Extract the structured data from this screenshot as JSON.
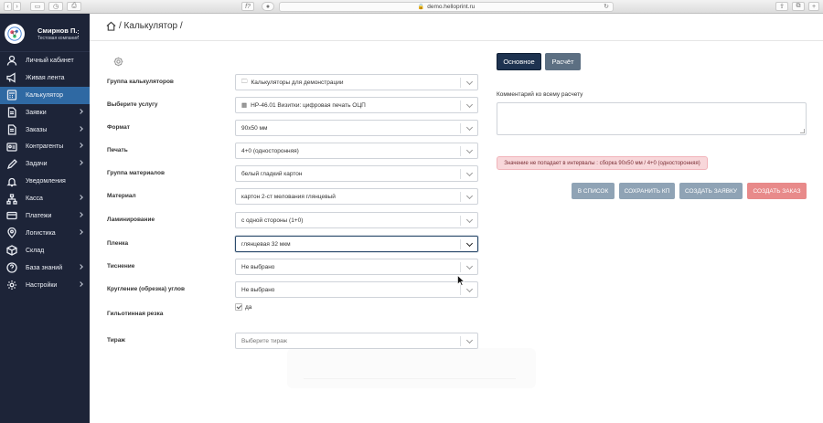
{
  "browser": {
    "url": "demo.helloprint.ru",
    "tab_label": "f?"
  },
  "profile": {
    "name": "Смирнов П.",
    "company": "Тестовая компания"
  },
  "sidebar": {
    "items": [
      {
        "label": "Личный кабинет",
        "icon": "user-icon"
      },
      {
        "label": "Живая лента",
        "icon": "megaphone-icon"
      },
      {
        "label": "Калькулятор",
        "icon": "calculator-icon",
        "active": true
      },
      {
        "label": "Заявки",
        "icon": "document-icon"
      },
      {
        "label": "Заказы",
        "icon": "document-icon"
      },
      {
        "label": "Контрагенты",
        "icon": "contact-card-icon"
      },
      {
        "label": "Задачи",
        "icon": "pencil-icon"
      },
      {
        "label": "Уведомления",
        "icon": "bell-icon"
      },
      {
        "label": "Касса",
        "icon": "sitemap-icon"
      },
      {
        "label": "Платежи",
        "icon": "card-icon"
      },
      {
        "label": "Логистика",
        "icon": "location-pin-icon"
      },
      {
        "label": "Склад",
        "icon": "box-icon"
      },
      {
        "label": "База знаний",
        "icon": "help-circle-icon"
      },
      {
        "label": "Настройки",
        "icon": "gear-icon"
      }
    ]
  },
  "breadcrumb": {
    "text": "/ Калькулятор /"
  },
  "form": {
    "rows": [
      {
        "label": "Группа калькуляторов",
        "value": "Калькуляторы для демонстрации",
        "prefix": "🗀"
      },
      {
        "label": "Выберите услугу",
        "value": "HP-46.01 Визитки: цифровая печать ОЦП",
        "prefix": "▦"
      },
      {
        "label": "Формат",
        "value": "90x50 мм"
      },
      {
        "label": "Печать",
        "value": "4+0 (односторонняя)"
      },
      {
        "label": "Группа материалов",
        "value": "белый гладкий картон"
      },
      {
        "label": "Материал",
        "value": "картон 2-ст мелования глянцевый"
      },
      {
        "label": "Ламинирование",
        "value": "с одной стороны (1+0)"
      },
      {
        "label": "Пленка",
        "value": "глянцевая 32 мкм",
        "focused": true
      },
      {
        "label": "Тиснение",
        "value": "Не выбрано"
      },
      {
        "label": "Кругление (обрезка) углов",
        "value": "Не выбрано"
      }
    ],
    "guillotine": {
      "label": "Гильотинная резка",
      "checkbox_label": "да",
      "checked": true
    },
    "tirage": {
      "label": "Тираж",
      "placeholder": "Выберите тираж"
    }
  },
  "tabs": {
    "main": "Основное",
    "calc": "Расчёт"
  },
  "comment": {
    "label": "Комментарий ко всему расчету",
    "value": ""
  },
  "alert": {
    "text": "Значение не попадает в интервалы : сборка 90х50 мм / 4+0 (односторонняя)"
  },
  "actions": {
    "to_list": "В СПИСОК",
    "save_kp": "СОХРАНИТЬ КП",
    "create_request": "СОЗДАТЬ ЗАЯВКУ",
    "create_order": "СОЗДАТЬ ЗАКАЗ"
  },
  "colors": {
    "sidebar_bg": "#1d2438",
    "sidebar_active": "#2f69a3",
    "primary_dark": "#1e3350",
    "secondary": "#5c6f82",
    "action_muted": "#8fa3b5",
    "danger": "#e88a8a",
    "alert_bg": "#f8d7da"
  }
}
